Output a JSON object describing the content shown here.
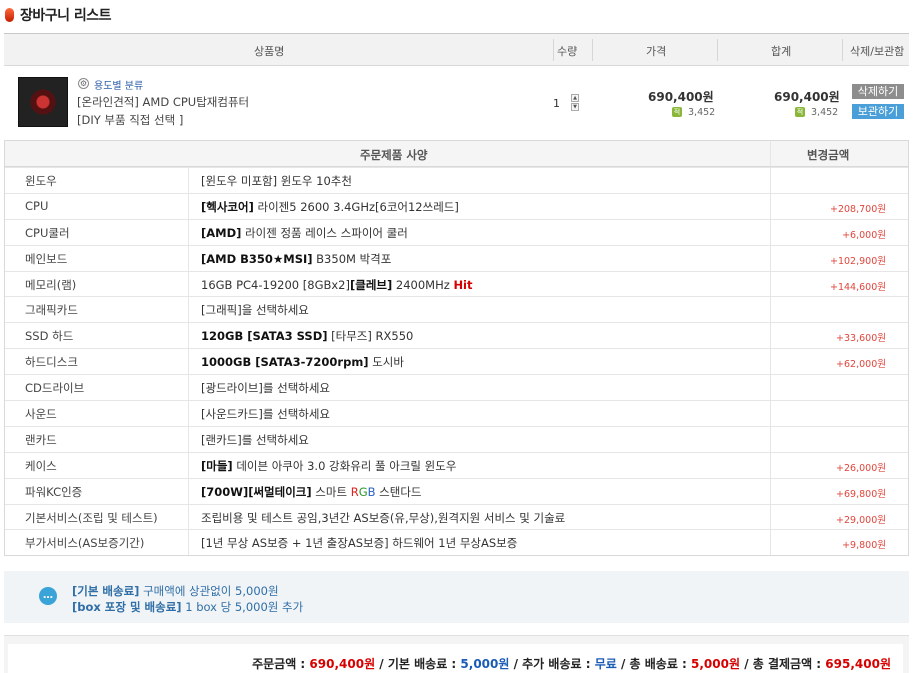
{
  "page": {
    "title": "장바구니 리스트"
  },
  "cart_header": {
    "product": "상품명",
    "qty": "수량",
    "price": "가격",
    "total": "합계",
    "action": "삭제/보관함"
  },
  "item": {
    "category_link": "용도별 분류",
    "name": "[온라인견적] AMD CPU탑재컴퓨터",
    "option": "[DIY 부품 직접 선택 ]",
    "qty": "1",
    "price": "690,400원",
    "price_points": "3,452",
    "total": "690,400원",
    "total_points": "3,452",
    "delete_label": "삭제하기",
    "save_label": "보관하기"
  },
  "spec": {
    "col_spec": "주문제품 사양",
    "col_change": "변경금액",
    "rows": [
      {
        "label": "윈도우",
        "value": "[윈도우 미포함] 윈도우 10추천",
        "price": ""
      },
      {
        "label": "CPU",
        "v1": "[헥사코어]",
        "v2": " 라이젠5 2600 3.4GHz[6코어12쓰레드]",
        "price": "+208,700원"
      },
      {
        "label": "CPU쿨러",
        "v1": "[AMD]",
        "v2": " 라이젠 정품 레이스 스파이어 쿨러",
        "price": "+6,000원"
      },
      {
        "label": "메인보드",
        "v1": "[AMD ",
        "v2": "B350",
        "v3": "★MSI]",
        "v4": " B350M 박격포",
        "price": "+102,900원"
      },
      {
        "label": "메모리(램)",
        "v1": "16GB PC4-19200 [8GBx2]",
        "v2": "[클레브]",
        "v3": " 2400MHz ",
        "v4": "Hit",
        "price": "+144,600원"
      },
      {
        "label": "그래픽카드",
        "value": "[그래픽]을 선택하세요",
        "price": ""
      },
      {
        "label": "SSD 하드",
        "v1": "120GB [",
        "v2": "SATA3",
        "v3": " SSD]",
        "v4": " [타무즈] RX550",
        "price": "+33,600원"
      },
      {
        "label": "하드디스크",
        "v1": "1000GB [",
        "v2": "SATA3",
        "v3": "-7200rpm]",
        "v4": " 도시바",
        "price": "+62,000원"
      },
      {
        "label": "CD드라이브",
        "value": "[광드라이브]를 선택하세요",
        "price": ""
      },
      {
        "label": "사운드",
        "value": "[사운드카드]를 선택하세요",
        "price": ""
      },
      {
        "label": "랜카드",
        "value": "[랜카드]를 선택하세요",
        "price": ""
      },
      {
        "label": "케이스",
        "v1": "[마들]",
        "v2": " 데이븐 아쿠아 3.0 강화유리 풀 아크릴 윈도우",
        "price": "+26,000원"
      },
      {
        "label": "파워KC인증",
        "v1": "[700W][써멀테이크]",
        "v2": " 스마트 ",
        "v3": "R",
        "v4": "G",
        "v5": "B",
        "v6": " 스탠다드",
        "price": "+69,800원"
      },
      {
        "label": "기본서비스(조립 및 테스트)",
        "value": "조립비용 및 테스트 공임,3년간 AS보증(유,무상),원격지원 서비스 및 기술료",
        "price": "+29,000원"
      },
      {
        "label": "부가서비스(AS보증기간)",
        "value": "[1년 무상 AS보증 + 1년 출장AS보증] 하드웨어 1년 무상AS보증",
        "price": "+9,800원"
      }
    ]
  },
  "shipping": {
    "line1_label": "[기본 배송료]",
    "line1_text": " 구매액에 상관없이 5,000원",
    "line2_label": "[box 포장 및 배송료]",
    "line2_text": " 1 box 당 5,000원 추가"
  },
  "totals": {
    "order_label": "주문금액 : ",
    "order_value": "690,400원",
    "base_ship_label": " / 기본 배송료 : ",
    "base_ship_value": "5,000원",
    "extra_ship_label": " / 추가 배송료 : ",
    "extra_ship_value": "무료",
    "total_ship_label": " / 총 배송료 : ",
    "total_ship_value": "5,000원",
    "grand_label": " / 총 결제금액 : ",
    "grand_value": "695,400원"
  },
  "colors": {
    "accent_red": "#d60000",
    "link_blue": "#2a5caa",
    "delete_btn": "#8d8d8d",
    "save_btn": "#4a9fd8",
    "point_green": "#8ab63a"
  }
}
